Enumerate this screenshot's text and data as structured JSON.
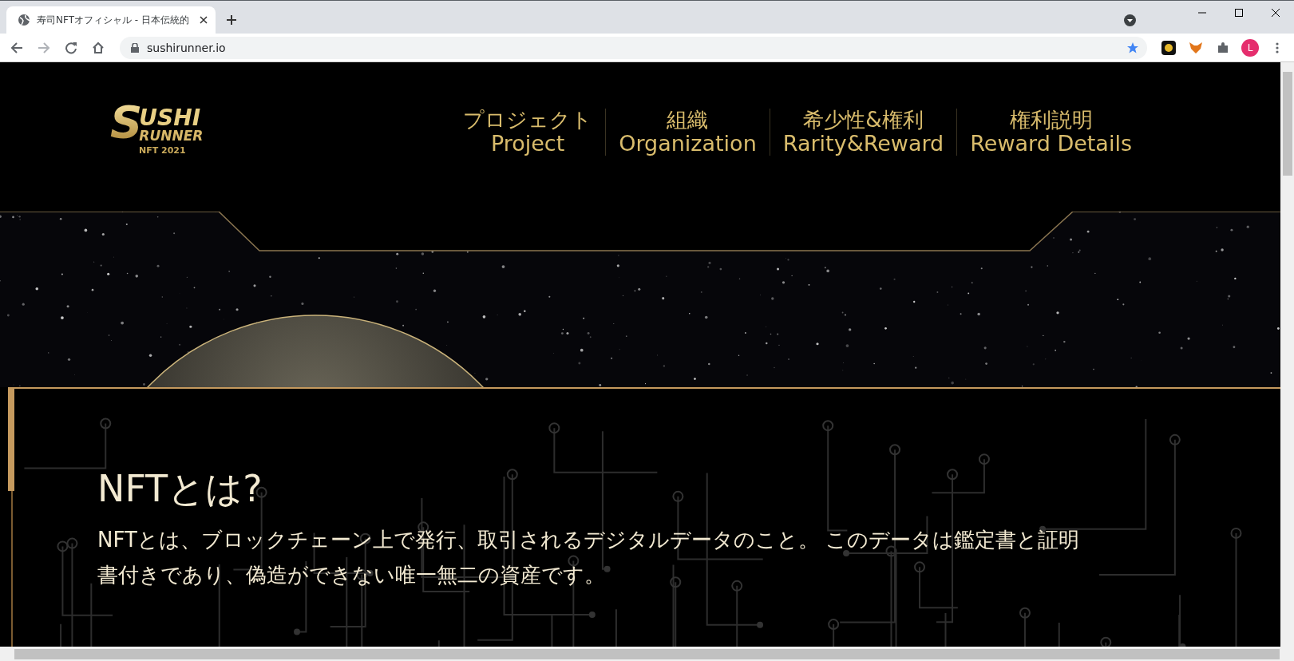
{
  "browser": {
    "tabs": [
      {
        "title": "寿司NFTオフィシャル - 日本伝統的",
        "selected": true
      }
    ],
    "address": "sushirunner.io",
    "profile_initial": "L"
  },
  "logo": {
    "big_letter": "S",
    "top_word": "USHI",
    "bottom_word": "RUNNER",
    "subtitle": "NFT 2021"
  },
  "nav": [
    {
      "ja": "プロジェクト",
      "en": "Project"
    },
    {
      "ja": "組織",
      "en": "Organization"
    },
    {
      "ja": "希少性&権利",
      "en": "Rarity&Reward"
    },
    {
      "ja": "権利説明",
      "en": "Reward Details"
    }
  ],
  "section": {
    "heading": "NFTとは?",
    "lines": [
      "NFTとは、ブロックチェーン上で発行、取引されるデジタルデータのこと。 このデータは鑑定書と証明",
      "書付きであり、偽造ができない唯一無二の資産です。"
    ]
  }
}
